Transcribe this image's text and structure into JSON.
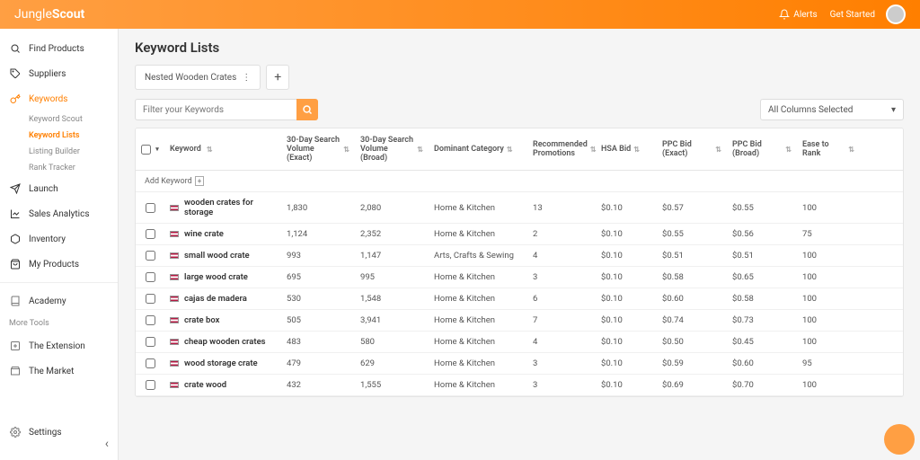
{
  "brand": {
    "name1": "Jungle",
    "name2": "Scout"
  },
  "header": {
    "alerts": "Alerts",
    "getstarted": "Get Started"
  },
  "sidebar": {
    "items": [
      {
        "label": "Find Products",
        "icon": "search"
      },
      {
        "label": "Suppliers",
        "icon": "tag"
      },
      {
        "label": "Keywords",
        "icon": "key",
        "active": true,
        "subs": [
          {
            "label": "Keyword Scout"
          },
          {
            "label": "Keyword Lists",
            "active": true
          },
          {
            "label": "Listing Builder"
          },
          {
            "label": "Rank Tracker"
          }
        ]
      },
      {
        "label": "Launch",
        "icon": "send"
      },
      {
        "label": "Sales Analytics",
        "icon": "chart"
      },
      {
        "label": "Inventory",
        "icon": "box"
      },
      {
        "label": "My Products",
        "icon": "bag"
      }
    ],
    "academy": "Academy",
    "moretools": "More Tools",
    "extension": "The Extension",
    "market": "The Market",
    "settings": "Settings"
  },
  "page": {
    "title": "Keyword Lists"
  },
  "tabs": {
    "active": "Nested Wooden Crates"
  },
  "search": {
    "placeholder": "Filter your Keywords"
  },
  "colselect": {
    "label": "All Columns Selected"
  },
  "columns": [
    "Keyword",
    "30-Day Search Volume (Exact)",
    "30-Day Search Volume (Broad)",
    "Dominant Category",
    "Recommended Promotions",
    "HSA Bid",
    "PPC Bid (Exact)",
    "PPC Bid (Broad)",
    "Ease to Rank"
  ],
  "addkw": "Add Keyword",
  "rows": [
    {
      "kw": "wooden crates for storage",
      "v1": "1,830",
      "v2": "2,080",
      "cat": "Home & Kitchen",
      "rec": "13",
      "hsa": "$0.10",
      "ppc1": "$0.57",
      "ppc2": "$0.55",
      "ease": "100"
    },
    {
      "kw": "wine crate",
      "v1": "1,124",
      "v2": "2,352",
      "cat": "Home & Kitchen",
      "rec": "2",
      "hsa": "$0.10",
      "ppc1": "$0.55",
      "ppc2": "$0.56",
      "ease": "75"
    },
    {
      "kw": "small wood crate",
      "v1": "993",
      "v2": "1,147",
      "cat": "Arts, Crafts & Sewing",
      "rec": "4",
      "hsa": "$0.10",
      "ppc1": "$0.51",
      "ppc2": "$0.51",
      "ease": "100"
    },
    {
      "kw": "large wood crate",
      "v1": "695",
      "v2": "995",
      "cat": "Home & Kitchen",
      "rec": "3",
      "hsa": "$0.10",
      "ppc1": "$0.58",
      "ppc2": "$0.65",
      "ease": "100"
    },
    {
      "kw": "cajas de madera",
      "v1": "530",
      "v2": "1,548",
      "cat": "Home & Kitchen",
      "rec": "6",
      "hsa": "$0.10",
      "ppc1": "$0.60",
      "ppc2": "$0.58",
      "ease": "100"
    },
    {
      "kw": "crate box",
      "v1": "505",
      "v2": "3,941",
      "cat": "Home & Kitchen",
      "rec": "7",
      "hsa": "$0.10",
      "ppc1": "$0.74",
      "ppc2": "$0.73",
      "ease": "100"
    },
    {
      "kw": "cheap wooden crates",
      "v1": "483",
      "v2": "580",
      "cat": "Home & Kitchen",
      "rec": "4",
      "hsa": "$0.10",
      "ppc1": "$0.50",
      "ppc2": "$0.45",
      "ease": "100"
    },
    {
      "kw": "wood storage crate",
      "v1": "479",
      "v2": "629",
      "cat": "Home & Kitchen",
      "rec": "3",
      "hsa": "$0.10",
      "ppc1": "$0.59",
      "ppc2": "$0.60",
      "ease": "95"
    },
    {
      "kw": "crate wood",
      "v1": "432",
      "v2": "1,555",
      "cat": "Home & Kitchen",
      "rec": "3",
      "hsa": "$0.10",
      "ppc1": "$0.69",
      "ppc2": "$0.70",
      "ease": "100"
    }
  ]
}
